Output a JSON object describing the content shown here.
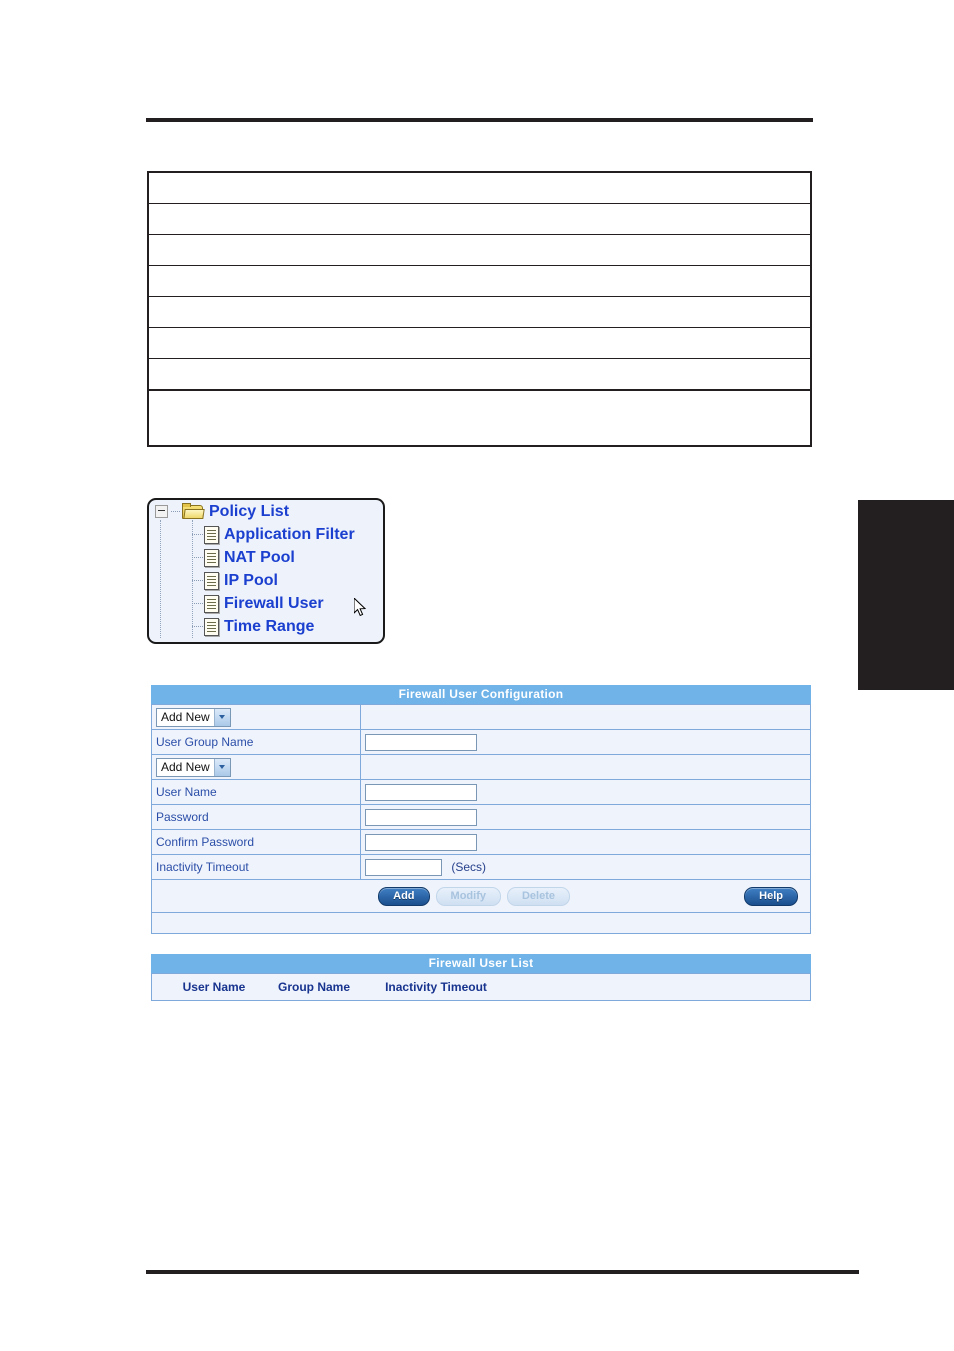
{
  "page": {
    "top_rule": "",
    "bottom_rule": "",
    "edge_tab": ""
  },
  "spec_table": {
    "rows": [
      "",
      "",
      "",
      "",
      "",
      "",
      "",
      ""
    ]
  },
  "tree": {
    "root": {
      "label": "Policy List",
      "icon": "folder-icon",
      "expander": "minus-expander-icon"
    },
    "children": [
      {
        "label": "Application Filter",
        "icon": "document-icon"
      },
      {
        "label": "NAT Pool",
        "icon": "document-icon"
      },
      {
        "label": "IP Pool",
        "icon": "document-icon"
      },
      {
        "label": "Firewall User",
        "icon": "document-icon"
      },
      {
        "label": "Time Range",
        "icon": "document-icon"
      }
    ],
    "cursor": "mouse-pointer-icon"
  },
  "config_panel": {
    "title": "Firewall User Configuration",
    "group_select": {
      "value": "Add New"
    },
    "group_name": {
      "label": "User Group Name",
      "value": ""
    },
    "user_select": {
      "value": "Add New"
    },
    "user_name": {
      "label": "User Name",
      "value": ""
    },
    "password": {
      "label": "Password",
      "value": ""
    },
    "confirm_password": {
      "label": "Confirm Password",
      "value": ""
    },
    "inactivity_timeout": {
      "label": "Inactivity Timeout",
      "value": "",
      "units": "(Secs)"
    },
    "buttons": {
      "add": "Add",
      "modify": "Modify",
      "delete": "Delete",
      "help": "Help"
    }
  },
  "list_panel": {
    "title": "Firewall User List",
    "columns": [
      "User Name",
      "Group Name",
      "Inactivity Timeout"
    ],
    "rows": []
  },
  "colors": {
    "header_blue": "#6fb3e8",
    "cell_bg": "#eff3fb",
    "border_blue": "#7fa9da",
    "label_blue": "#2b4ea8",
    "tree_link": "#1b3fcf",
    "button_on": "#1b4f8e",
    "rule_black": "#231f20"
  }
}
